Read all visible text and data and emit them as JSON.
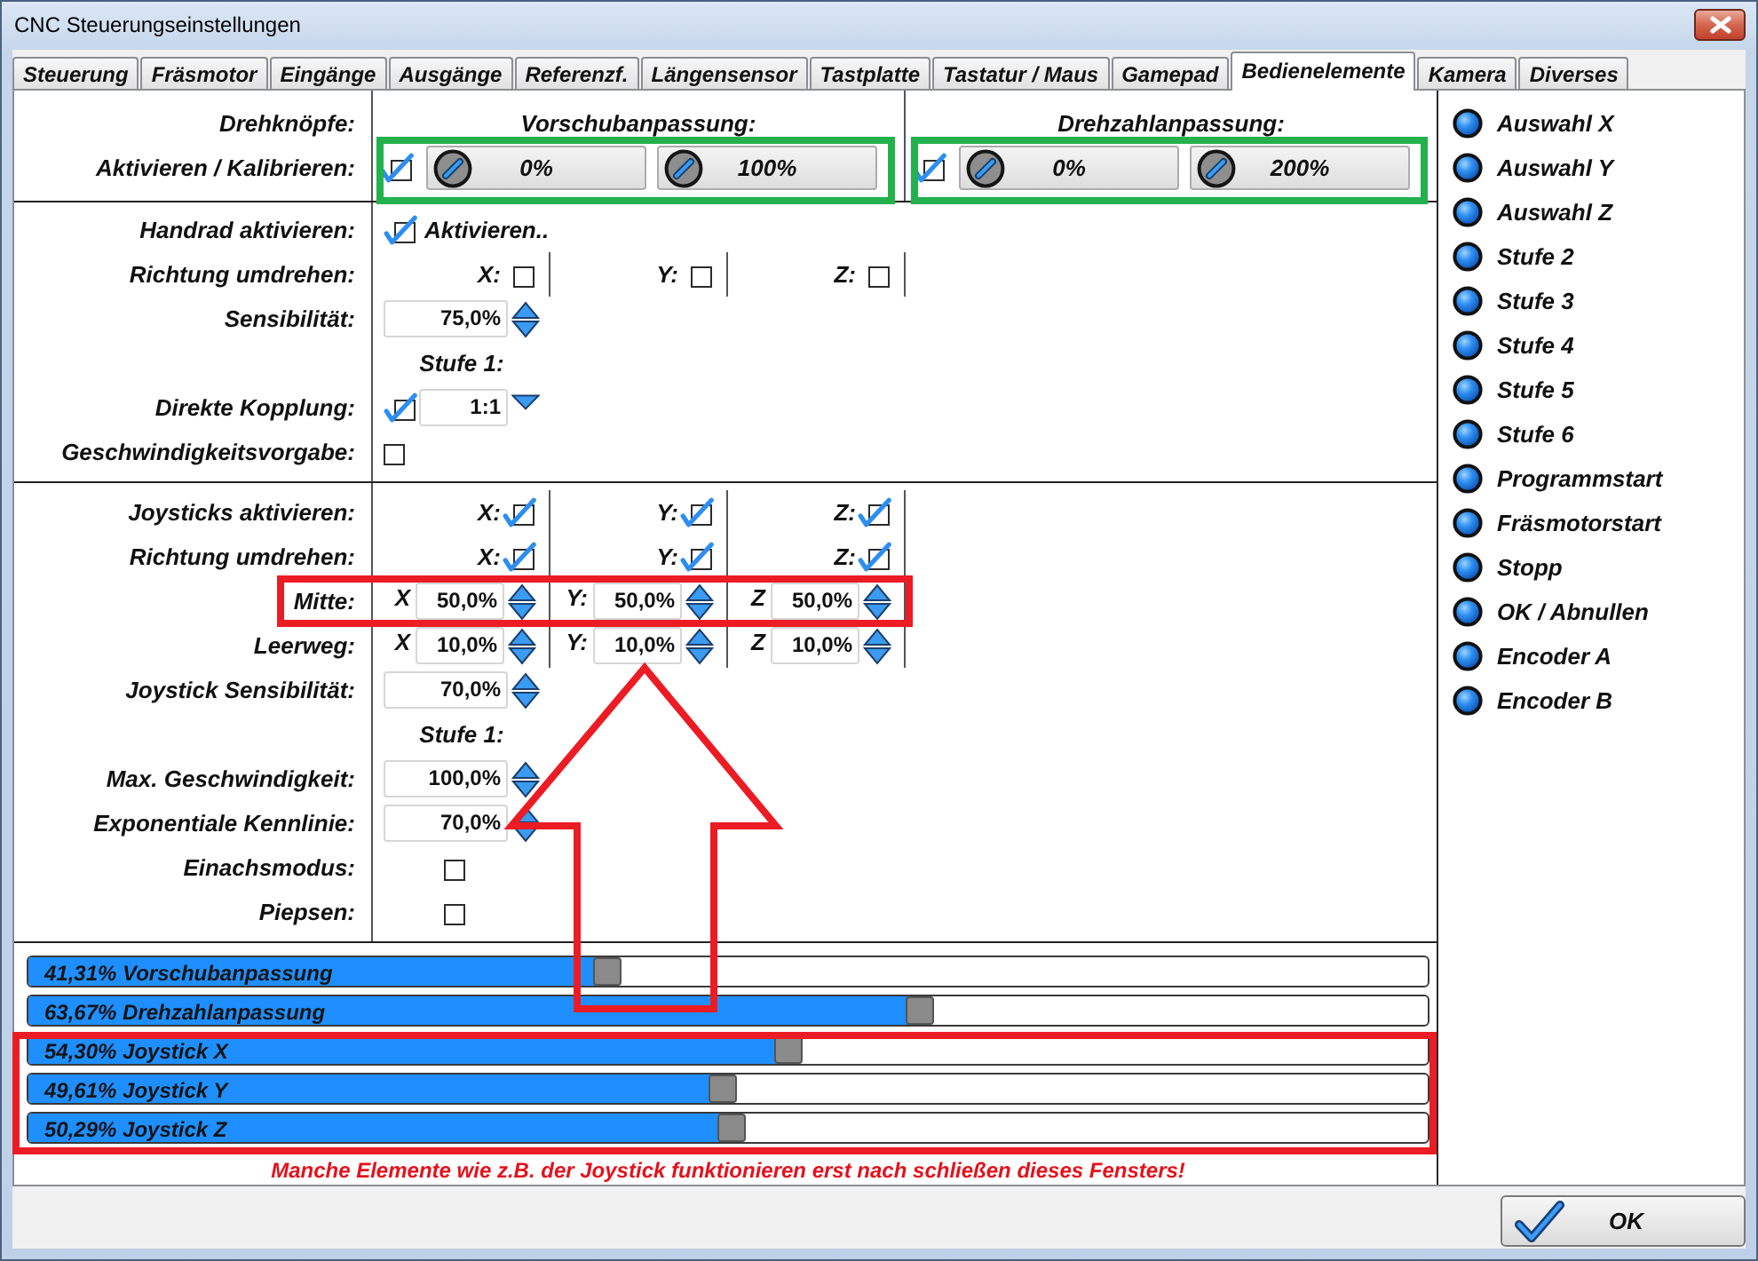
{
  "window": {
    "title": "CNC Steuerungseinstellungen"
  },
  "tabs": [
    {
      "label": "Steuerung",
      "selected": false
    },
    {
      "label": "Fräsmotor",
      "selected": false
    },
    {
      "label": "Eingänge",
      "selected": false
    },
    {
      "label": "Ausgänge",
      "selected": false
    },
    {
      "label": "Referenzf.",
      "selected": false
    },
    {
      "label": "Längensensor",
      "selected": false
    },
    {
      "label": "Tastplatte",
      "selected": false
    },
    {
      "label": "Tastatur / Maus",
      "selected": false
    },
    {
      "label": "Gamepad",
      "selected": false
    },
    {
      "label": "Bedienelemente",
      "selected": true
    },
    {
      "label": "Kamera",
      "selected": false
    },
    {
      "label": "Diverses",
      "selected": false
    }
  ],
  "knobs": {
    "label": "Drehknöpfe:",
    "row_label": "Aktivieren / Kalibrieren:",
    "groups": [
      {
        "title": "Vorschubanpassung:",
        "checked": true,
        "buttons": [
          "0%",
          "100%"
        ]
      },
      {
        "title": "Drehzahlanpassung:",
        "checked": true,
        "buttons": [
          "0%",
          "200%"
        ]
      }
    ]
  },
  "sections": [
    {
      "rows": [
        {
          "kind": "check_text",
          "label": "Handrad aktivieren:",
          "checked": true,
          "text": "Aktivieren.."
        },
        {
          "kind": "axis_checks",
          "label": "Richtung umdrehen:",
          "axes": [
            {
              "label": "X:",
              "checked": false
            },
            {
              "label": "Y:",
              "checked": false
            },
            {
              "label": "Z:",
              "checked": false
            }
          ]
        },
        {
          "kind": "spin",
          "label": "Sensibilität:",
          "value": "75,0%"
        },
        {
          "kind": "heading",
          "text": "Stufe 1:"
        },
        {
          "kind": "check_combo",
          "label": "Direkte Kopplung:",
          "checked": true,
          "value": "1:1"
        },
        {
          "kind": "check",
          "label": "Geschwindigkeitsvorgabe:",
          "checked": false
        }
      ]
    },
    {
      "rows": [
        {
          "kind": "axis_checks",
          "label": "Joysticks aktivieren:",
          "axes": [
            {
              "label": "X:",
              "checked": true
            },
            {
              "label": "Y:",
              "checked": true
            },
            {
              "label": "Z:",
              "checked": true
            }
          ]
        },
        {
          "kind": "axis_checks",
          "label": "Richtung umdrehen:",
          "axes": [
            {
              "label": "X:",
              "checked": true
            },
            {
              "label": "Y:",
              "checked": true
            },
            {
              "label": "Z:",
              "checked": true
            }
          ]
        },
        {
          "kind": "axis_spins",
          "label": "Mitte:",
          "axes": [
            {
              "label": "X",
              "value": "50,0%"
            },
            {
              "label": "Y:",
              "value": "50,0%"
            },
            {
              "label": "Z",
              "value": "50,0%"
            }
          ]
        },
        {
          "kind": "axis_spins",
          "label": "Leerweg:",
          "axes": [
            {
              "label": "X",
              "value": "10,0%"
            },
            {
              "label": "Y:",
              "value": "10,0%"
            },
            {
              "label": "Z",
              "value": "10,0%"
            }
          ]
        },
        {
          "kind": "spin",
          "label": "Joystick Sensibilität:",
          "value": "70,0%"
        },
        {
          "kind": "heading",
          "text": "Stufe 1:"
        },
        {
          "kind": "spin",
          "label": "Max. Geschwindigkeit:",
          "value": "100,0%"
        },
        {
          "kind": "spin",
          "label": "Exponentiale Kennlinie:",
          "value": "70,0%"
        },
        {
          "kind": "check",
          "label": "Einachsmodus:",
          "checked": false
        },
        {
          "kind": "check",
          "label": "Piepsen:",
          "checked": false
        }
      ]
    }
  ],
  "meters": [
    {
      "label": "41,31% Vorschubanpassung",
      "level": 0.4131
    },
    {
      "label": "63,67% Drehzahlanpassung",
      "level": 0.6367
    },
    {
      "label": "54,30% Joystick X",
      "level": 0.543
    },
    {
      "label": "49,61% Joystick Y",
      "level": 0.4961
    },
    {
      "label": "50,29% Joystick Z",
      "level": 0.5029
    }
  ],
  "notice": "Manche Elemente wie z.B. der Joystick funktionieren erst nach schließen dieses Fensters!",
  "inputs": [
    "Auswahl X",
    "Auswahl Y",
    "Auswahl Z",
    "Stufe 2",
    "Stufe 3",
    "Stufe 4",
    "Stufe 5",
    "Stufe 6",
    "Programmstart",
    "Fräsmotorstart",
    "Stopp",
    "OK / Abnullen",
    "Encoder A",
    "Encoder B"
  ],
  "ok_button": "OK"
}
